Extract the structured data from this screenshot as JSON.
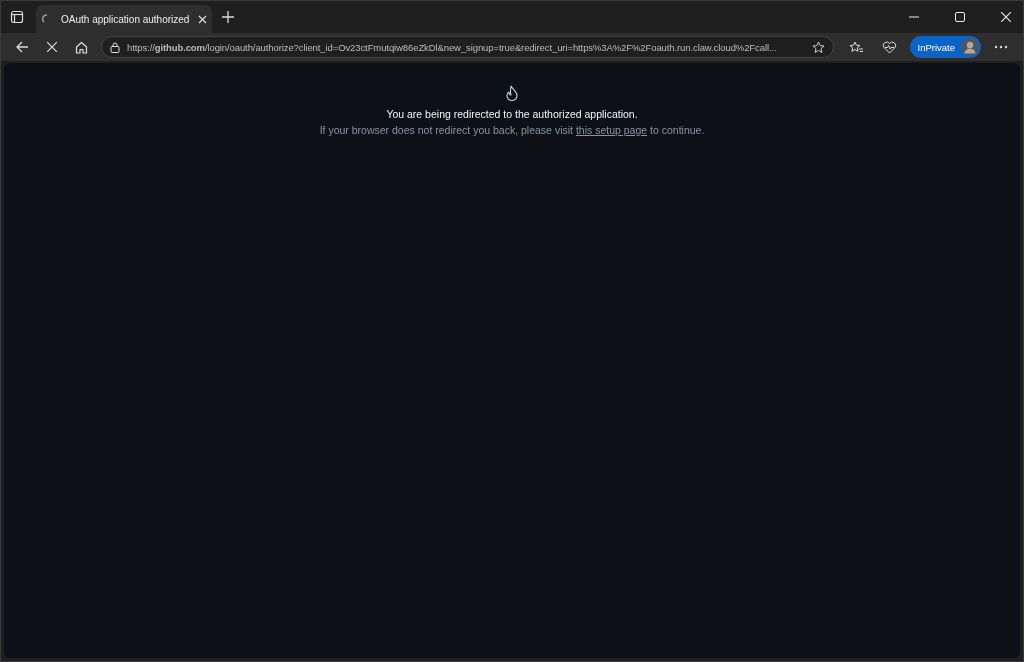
{
  "tabs": [
    {
      "title": "OAuth application authorized",
      "selected": true,
      "loading": true
    }
  ],
  "address_bar": {
    "url": "https://**github.com**/login/oauth/authorize?client_id=Ov23ctFmutqiw86eZkDl&new_signup=true&redirect_uri=https%3A%2F%2Foauth.run.claw.cloud%2Fcall..."
  },
  "profile": {
    "label": "InPrivate"
  },
  "page": {
    "heading": "You are being redirected to the authorized application.",
    "note_before": "If your browser does not redirect you back, please visit ",
    "note_link": "this setup page",
    "note_after": " to continue."
  }
}
